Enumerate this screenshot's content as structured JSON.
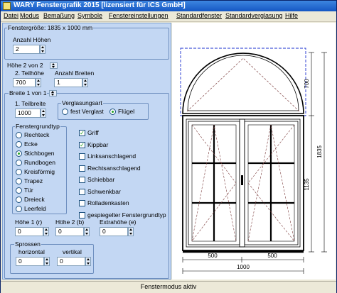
{
  "window": {
    "title": "WARY Fenstergrafik 2015  [lizensiert für ICS GmbH]"
  },
  "menu": [
    "Datei",
    "Modus",
    "Bemaßung",
    "Symbole",
    "Fenstereinstellungen",
    "Standardfenster",
    "Standardverglasung",
    "Hilfe"
  ],
  "panel": {
    "size_group_label": "Fenstergröße: 1835 x 1000 mm",
    "heights_label": "Anzahl Höhen",
    "heights_value": "2",
    "height_nav_label": "Höhe 2 von 2",
    "part_height_label": "2. Teilhöhe",
    "part_height_value": "700",
    "widths_label": "Anzahl Breiten",
    "widths_value": "1",
    "width_nav_label": "Breite 1 von 1",
    "part_width_label": "1. Teilbreite",
    "part_width_value": "1000",
    "glazing_group_label": "Verglasungsart",
    "glazing_options": [
      {
        "label": "fest Verglast",
        "selected": false
      },
      {
        "label": "Flügel",
        "selected": true
      }
    ],
    "shape_group_label": "Fenstergrundtyp",
    "shapes": [
      {
        "label": "Rechteck",
        "selected": false
      },
      {
        "label": "Ecke",
        "selected": false
      },
      {
        "label": "Stichbogen",
        "selected": true
      },
      {
        "label": "Rundbogen",
        "selected": false
      },
      {
        "label": "Kreisförmig",
        "selected": false
      },
      {
        "label": "Trapez",
        "selected": false
      },
      {
        "label": "Tür",
        "selected": false
      },
      {
        "label": "Dreieck",
        "selected": false
      },
      {
        "label": "Leerfeld",
        "selected": false
      }
    ],
    "options": [
      {
        "label": "Griff",
        "checked": true
      },
      {
        "label": "Kippbar",
        "checked": true
      },
      {
        "label": "Linksanschlagend",
        "checked": false
      },
      {
        "label": "Rechtsanschlagend",
        "checked": false
      },
      {
        "label": "Schiebbar",
        "checked": false
      },
      {
        "label": "Schwenkbar",
        "checked": false
      },
      {
        "label": "Rolladenkasten",
        "checked": false
      },
      {
        "label": "gespiegelter Fenstergrundtyp",
        "checked": false
      }
    ],
    "height_r_label": "Höhe 1 (r)",
    "height_r_value": "0",
    "height_b_label": "Höhe 2 (b)",
    "height_b_value": "0",
    "extra_height_label": "Extrahöhe (e)",
    "extra_height_value": "0",
    "sprossen_label": "Sprossen",
    "horizontal_label": "horizontal",
    "horizontal_value": "0",
    "vertical_label": "vertikal",
    "vertical_value": "0"
  },
  "drawing": {
    "dim_700": "700",
    "dim_1835": "1835",
    "dim_1135": "1135",
    "dim_500_left": "500",
    "dim_500_right": "500",
    "dim_1000": "1000",
    "frame_color": "#000000",
    "selection_color": "#1a2fcf",
    "opening_line_color": "#7a3a3a"
  },
  "status": {
    "text": "Fenstermodus aktiv"
  },
  "icons": [
    "app-icon",
    "spin-arrows-icon",
    "toggle-arrows-icon"
  ]
}
